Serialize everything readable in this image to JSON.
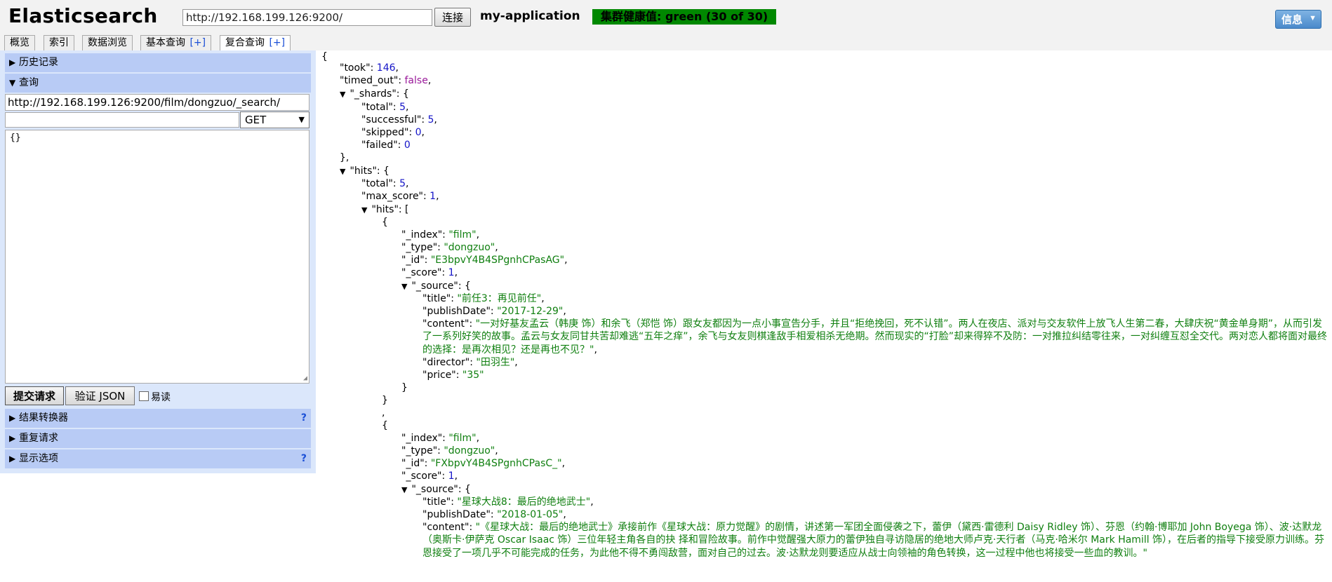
{
  "header": {
    "title": "Elasticsearch",
    "cluster_url": "http://192.168.199.126:9200/",
    "connect_label": "连接",
    "cluster_name": "my-application",
    "health": "集群健康值: green (30 of 30)",
    "health_color": "#008800",
    "info_label": "信息"
  },
  "tabs": [
    {
      "label": "概览"
    },
    {
      "label": "索引"
    },
    {
      "label": "数据浏览"
    },
    {
      "label": "基本查询",
      "plus": "[+]"
    },
    {
      "label": "复合查询",
      "plus": "[+]",
      "active": true
    }
  ],
  "left": {
    "history": "历史记录",
    "query": "查询",
    "query_url": "http://192.168.199.126:9200/film/dongzuo/_search/",
    "query_path": "",
    "method": "GET",
    "body": "{}",
    "submit_label": "提交请求",
    "validate_label": "验证 JSON",
    "pretty_label": "易读",
    "transformer": "结果转换器",
    "repeat": "重复请求",
    "display": "显示选项",
    "help": "?"
  },
  "result": {
    "took": "146",
    "timed_out": "false",
    "shards": {
      "total": "5",
      "successful": "5",
      "skipped": "0",
      "failed": "0"
    },
    "hits_total": "5",
    "max_score": "1",
    "hit1": {
      "index": "\"film\"",
      "type": "\"dongzuo\"",
      "id": "\"E3bpvY4B4SPgnhCPasAG\"",
      "score": "1",
      "title": "\"前任3：再见前任\"",
      "publishDate": "\"2017-12-29\"",
      "content": "\"一对好基友孟云（韩庚 饰）和余飞（郑恺 饰）跟女友都因为一点小事宣告分手，并且“拒绝挽回，死不认错”。两人在夜店、派对与交友软件上放飞人生第二春，大肆庆祝“黄金单身期”，从而引发了一系列好笑的故事。孟云与女友同甘共苦却难逃“五年之痒”，余飞与女友则棋逢敌手相爱相杀无绝期。然而现实的“打脸”却来得猝不及防：一对推拉纠结零往来，一对纠缠互怼全交代。两对恋人都将面对最终的选择：是再次相见？还是再也不见？\"",
      "director": "\"田羽生\"",
      "price": "\"35\""
    },
    "hit2": {
      "index": "\"film\"",
      "type": "\"dongzuo\"",
      "id": "\"FXbpvY4B4SPgnhCPasC_\"",
      "score": "1",
      "title": "\"星球大战8：最后的绝地武士\"",
      "publishDate": "\"2018-01-05\"",
      "content": "\"《星球大战：最后的绝地武士》承接前作《星球大战：原力觉醒》的剧情，讲述第一军团全面侵袭之下，蕾伊（黛西·雷德利 Daisy Ridley 饰）、芬恩（约翰·博耶加 John Boyega 饰）、波·达默龙（奥斯卡·伊萨克 Oscar Isaac 饰）三位年轻主角各自的抉 择和冒险故事。前作中觉醒强大原力的蕾伊独自寻访隐居的绝地大师卢克·天行者（马克·哈米尔 Mark Hamill 饰），在后者的指导下接受原力训练。芬恩接受了一项几乎不可能完成的任务，为此他不得不勇闯敌营，面对自己的过去。波·达默龙则要适应从战士向领袖的角色转换，这一过程中他也将接受一些血的教训。\""
    }
  }
}
